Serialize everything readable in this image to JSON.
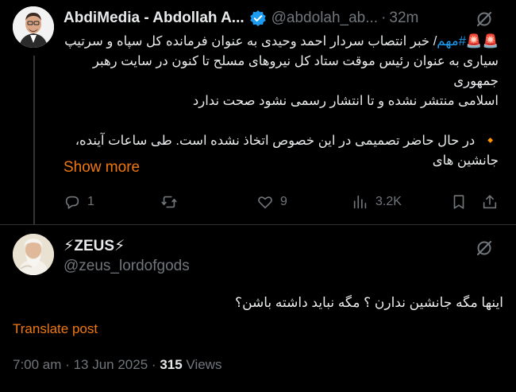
{
  "post1": {
    "display_name": "AbdiMedia - Abdollah A...",
    "handle": "@abdolah_ab...",
    "separator": "·",
    "time": "32m",
    "siren1": "🚨",
    "siren2": "🚨",
    "hashtag": "#مهم",
    "text_line1_rest": "/ خبر انتصاب سردار احمد وحیدی به عنوان فرمانده کل سپاه و سرتیپ",
    "text_line2": "سیاری به عنوان رئیس موقت ستاد کل نیروهای مسلح تا کنون در سایت رهبر جمهوری",
    "text_line3": "اسلامی منتشر نشده و تا انتشار رسمی نشود صحت ندارد",
    "bullet": "🔸",
    "text_line4": "در حال حاضر تصمیمی در این خصوص اتخاذ نشده است. طی ساعات آینده،",
    "text_line5": "جانشین های",
    "show_more": "Show more",
    "actions": {
      "replies": "1",
      "reposts": "",
      "likes": "9",
      "views": "3.2K"
    }
  },
  "post2": {
    "display_name": "⚡ZEUS⚡",
    "handle": "@zeus_lordofgods",
    "text": "اینها مگه جانشین ندارن ؟ مگه نباید داشته باشن؟",
    "translate": "Translate post",
    "time": "7:00 am",
    "separator": "·",
    "date": "13 Jun 2025",
    "views_count": "315",
    "views_label": "Views"
  },
  "colors": {
    "background": "#000000",
    "text": "#e7e9ea",
    "muted": "#71767b",
    "accent": "#f0780f",
    "hashtag": "#1d9bf0",
    "verified": "#1d9bf0"
  },
  "icons": [
    "verified-badge-icon",
    "grok-icon",
    "reply-icon",
    "repost-icon",
    "like-icon",
    "views-icon",
    "bookmark-icon",
    "share-icon"
  ]
}
